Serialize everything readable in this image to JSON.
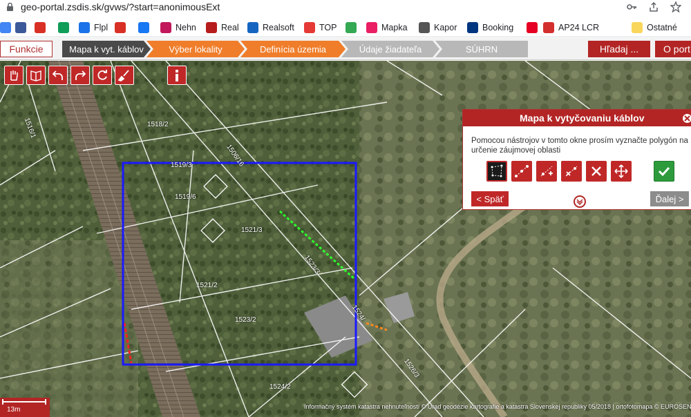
{
  "browser": {
    "url": "geo-portal.zsdis.sk/gvws/?start=anonimousExt",
    "bookmarks": [
      {
        "label": "",
        "icon": "bookmark-1-icon",
        "color": "#4285f4"
      },
      {
        "label": "",
        "icon": "bookmark-2-icon",
        "color": "#3b5998"
      },
      {
        "label": "",
        "icon": "bookmark-3-icon",
        "color": "#d93025"
      },
      {
        "label": "",
        "icon": "bookmark-4-icon",
        "color": "#0f9d58"
      },
      {
        "label": "Flpl",
        "icon": "flpl-icon",
        "color": "#1a73e8"
      },
      {
        "label": "",
        "icon": "no-sign-icon",
        "color": "#d93025"
      },
      {
        "label": "",
        "icon": "facebook-icon",
        "color": "#1877f2"
      },
      {
        "label": "Nehn",
        "icon": "nehn-icon",
        "color": "#c2185b"
      },
      {
        "label": "Real",
        "icon": "real-icon",
        "color": "#b71c1c"
      },
      {
        "label": "Realsoft",
        "icon": "realsoft-icon",
        "color": "#1565c0"
      },
      {
        "label": "TOP",
        "icon": "top-icon",
        "color": "#e53935"
      },
      {
        "label": "",
        "icon": "maps-pin-icon",
        "color": "#34a853"
      },
      {
        "label": "Mapka",
        "icon": "mapka-icon",
        "color": "#e91e63"
      },
      {
        "label": "Kapor",
        "icon": "kapor-icon",
        "color": "#555555"
      },
      {
        "label": "Booking",
        "icon": "booking-icon",
        "color": "#003580"
      },
      {
        "label": "",
        "icon": "pinterest-icon",
        "color": "#e60023"
      },
      {
        "label": "AP24 LCR",
        "icon": "ap24-icon",
        "color": "#d32f2f"
      },
      {
        "label": "Ostatné",
        "icon": "folder-icon",
        "color": "#f9d65c"
      }
    ]
  },
  "toolbar": {
    "funkcie": "Funkcie",
    "steps": [
      "Mapa k vyt. káblov",
      "Výber lokality",
      "Definícia územia",
      "Údaje žiadateľa",
      "SÚHRN"
    ],
    "search": "Hľadaj ...",
    "portal": "O port"
  },
  "map": {
    "parcels": [
      "1518/2",
      "1519/3",
      "1519/6",
      "1521/3",
      "1521/2",
      "1523/2",
      "1523/3",
      "1524/2",
      "1506/16",
      "1524/",
      "1526/3",
      "1516/1"
    ],
    "scale": "13m",
    "attribution": "Informačný systém katastra nehnuteľností © Úrad geodézie kartografie a katastra Slovenskej republiky 05/2018 | ortofotomapa © EUROSENSE"
  },
  "dialog": {
    "title": "Mapa k vytyčovaniu káblov",
    "text": "Pomocou nástrojov v tomto okne prosím vyznačte polygón na určenie záujmovej oblasti",
    "back": "< Späť",
    "next": "Ďalej >"
  },
  "colors": {
    "brand_red": "#b32525",
    "step_active": "#4a4a4a",
    "step_orange": "#f07d2a",
    "step_grey": "#b8b8b8",
    "selection": "#1a1aff",
    "ok_green": "#2d9b3c"
  }
}
